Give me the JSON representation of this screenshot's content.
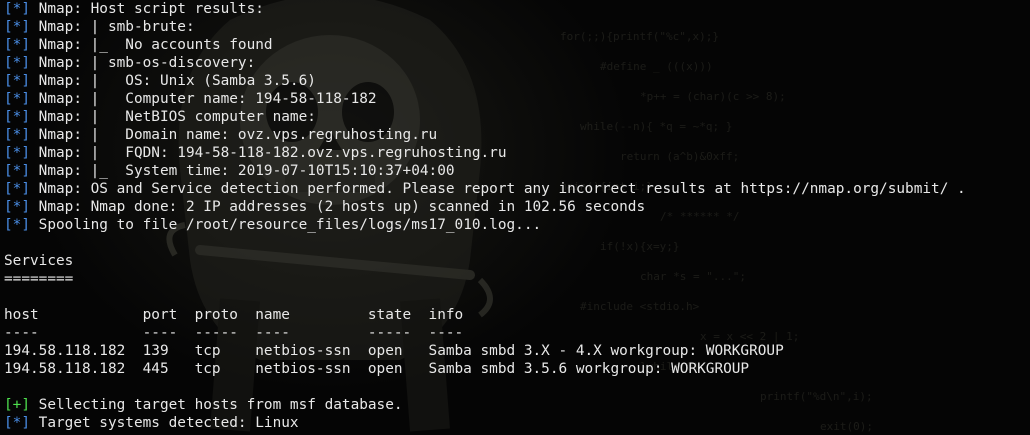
{
  "colors": {
    "background": "#000000",
    "text": "#e8e8e8",
    "info_marker": "#4a8ee6",
    "good_marker": "#4ee04e"
  },
  "terminal": {
    "lines": [
      {
        "marker": "[*]",
        "marker_type": "info",
        "text": " Nmap: Host script results:"
      },
      {
        "marker": "[*]",
        "marker_type": "info",
        "text": " Nmap: | smb-brute:"
      },
      {
        "marker": "[*]",
        "marker_type": "info",
        "text": " Nmap: |_  No accounts found"
      },
      {
        "marker": "[*]",
        "marker_type": "info",
        "text": " Nmap: | smb-os-discovery:"
      },
      {
        "marker": "[*]",
        "marker_type": "info",
        "text": " Nmap: |   OS: Unix (Samba 3.5.6)"
      },
      {
        "marker": "[*]",
        "marker_type": "info",
        "text": " Nmap: |   Computer name: 194-58-118-182"
      },
      {
        "marker": "[*]",
        "marker_type": "info",
        "text": " Nmap: |   NetBIOS computer name:"
      },
      {
        "marker": "[*]",
        "marker_type": "info",
        "text": " Nmap: |   Domain name: ovz.vps.regruhosting.ru"
      },
      {
        "marker": "[*]",
        "marker_type": "info",
        "text": " Nmap: |   FQDN: 194-58-118-182.ovz.vps.regruhosting.ru"
      },
      {
        "marker": "[*]",
        "marker_type": "info",
        "text": " Nmap: |_  System time: 2019-07-10T15:10:37+04:00"
      },
      {
        "marker": "[*]",
        "marker_type": "info",
        "text": " Nmap: OS and Service detection performed. Please report any incorrect results at https://nmap.org/submit/ ."
      },
      {
        "marker": "[*]",
        "marker_type": "info",
        "text": " Nmap: Nmap done: 2 IP addresses (2 hosts up) scanned in 102.56 seconds"
      },
      {
        "marker": "[*]",
        "marker_type": "info",
        "text": " Spooling to file /root/resource_files/logs/ms17_010.log..."
      },
      {
        "marker": "",
        "marker_type": "none",
        "text": ""
      },
      {
        "marker": "",
        "marker_type": "none",
        "text": "Services"
      },
      {
        "marker": "",
        "marker_type": "none",
        "text": "========"
      },
      {
        "marker": "",
        "marker_type": "none",
        "text": ""
      },
      {
        "marker": "",
        "marker_type": "none",
        "text": "host            port  proto  name         state  info"
      },
      {
        "marker": "",
        "marker_type": "none",
        "text": "----            ----  -----  ----         -----  ----"
      },
      {
        "marker": "",
        "marker_type": "none",
        "text": "194.58.118.182  139   tcp    netbios-ssn  open   Samba smbd 3.X - 4.X workgroup: WORKGROUP"
      },
      {
        "marker": "",
        "marker_type": "none",
        "text": "194.58.118.182  445   tcp    netbios-ssn  open   Samba smbd 3.5.6 workgroup: WORKGROUP"
      },
      {
        "marker": "",
        "marker_type": "none",
        "text": ""
      },
      {
        "marker": "[+]",
        "marker_type": "good",
        "text": " Sellecting target hosts from msf database."
      },
      {
        "marker": "[*]",
        "marker_type": "info",
        "text": " Target systems detected: Linux"
      }
    ]
  }
}
